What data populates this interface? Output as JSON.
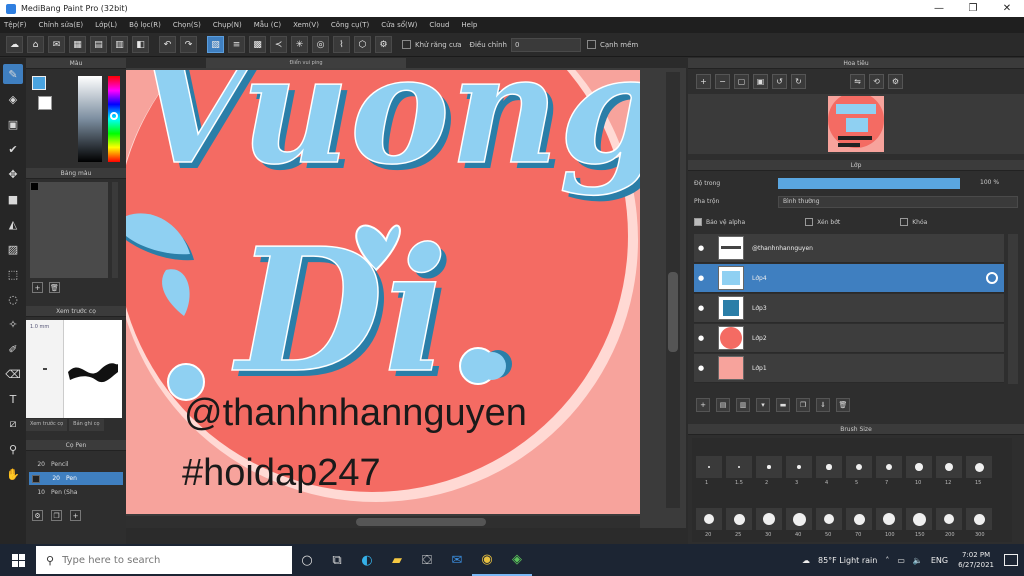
{
  "window": {
    "title": "MediBang Paint Pro (32bit)",
    "min": "—",
    "max": "❐",
    "close": "✕"
  },
  "menu": [
    "Tệp(F)",
    "Chỉnh sửa(E)",
    "Lớp(L)",
    "Bộ lọc(R)",
    "Chọn(S)",
    "Chụp(N)",
    "Mẫu (C)",
    "Xem(V)",
    "Công cụ(T)",
    "Cửa sổ(W)",
    "Cloud",
    "Help"
  ],
  "toolbar": {
    "auto_select_label": "Khử răng cưa",
    "correction_label": "Điều chỉnh",
    "correction_value": "0",
    "snap_label": "Cạnh mềm"
  },
  "panels": {
    "color": "Màu",
    "palette": "Bảng màu",
    "brush_preview": "Xem trước cọ",
    "brush_preview_small": "1.0 mm",
    "brush_tab_1": "Xem trước cọ",
    "brush_tab_2": "Bản ghi cọ",
    "brush": "Cọ Pen",
    "navigator": "Hoa tiêu",
    "layer": "Lớp",
    "brush_size": "Brush Size"
  },
  "document": {
    "tab": "Điển vui ping"
  },
  "artwork": {
    "text_1": "Vuong",
    "text_2": "Di",
    "watermark_1": "@thanhnhannguyen",
    "watermark_2": "#hoidap247",
    "bg_color": "#f7a39c",
    "circle_color": "#f46b63",
    "letter_color": "#8fd0f2",
    "shadow_color": "#2a7ea8"
  },
  "brushes": [
    {
      "size": "20",
      "name": "Pencil",
      "selected": false
    },
    {
      "size": "20",
      "name": "Pen",
      "selected": true
    },
    {
      "size": "10",
      "name": "Pen (Sha",
      "selected": false
    }
  ],
  "layer_panel": {
    "opacity_label": "Độ trong",
    "opacity_value": "100 %",
    "opacity": 0.93,
    "blend_label": "Pha trộn",
    "blend_value": "Bình thường",
    "protect_label": "Bảo vệ alpha",
    "clip_label": "Xén bớt",
    "lock_label": "Khóa",
    "layers": [
      {
        "name": "@thanhnhannguyen",
        "selected": false
      },
      {
        "name": "Lớp4",
        "selected": true
      },
      {
        "name": "Lớp3",
        "selected": false
      },
      {
        "name": "Lớp2",
        "selected": false
      },
      {
        "name": "Lớp1",
        "selected": false
      }
    ]
  },
  "brush_sizes": [
    "1",
    "1.5",
    "2",
    "3",
    "4",
    "5",
    "7",
    "10",
    "12",
    "15",
    "20",
    "25",
    "30",
    "40",
    "50",
    "70",
    "100",
    "150",
    "200",
    "300"
  ],
  "taskbar": {
    "search_placeholder": "Type here to search",
    "weather": "85°F Light rain",
    "lang": "ENG",
    "time": "7:02 PM",
    "date": "6/27/2021"
  }
}
